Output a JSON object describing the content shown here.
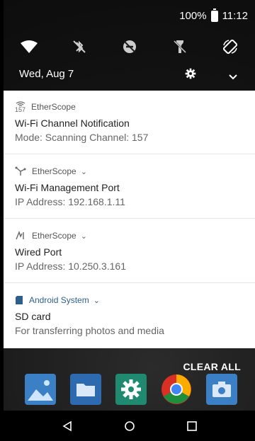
{
  "statusbar": {
    "battery": "100%",
    "time": "11:12"
  },
  "quick_settings": {
    "date": "Wed, Aug 7"
  },
  "notifications": [
    {
      "app": "EtherScope",
      "title": "Wi-Fi Channel Notification",
      "text": "Mode: Scanning Channel: 157",
      "icon": "wifi-channel-icon",
      "icon_text": "157"
    },
    {
      "app": "EtherScope",
      "title": "Wi-Fi Management Port",
      "text": "IP Address: 192.168.1.11",
      "icon": "fork-icon"
    },
    {
      "app": "EtherScope",
      "title": "Wired Port",
      "text": "IP Address: 10.250.3.161",
      "icon": "wired-port-icon"
    },
    {
      "app": "Android System",
      "title": "SD card",
      "text": "For transferring photos and media",
      "icon": "sd-card-icon"
    }
  ],
  "clear_all": "CLEAR ALL",
  "dock_apps": [
    "gallery-icon",
    "files-icon",
    "settings-icon",
    "chrome-icon",
    "camera-icon"
  ],
  "colors": {
    "android_system": "#2d5f8a",
    "qs_bg": "#1b1b1b"
  }
}
